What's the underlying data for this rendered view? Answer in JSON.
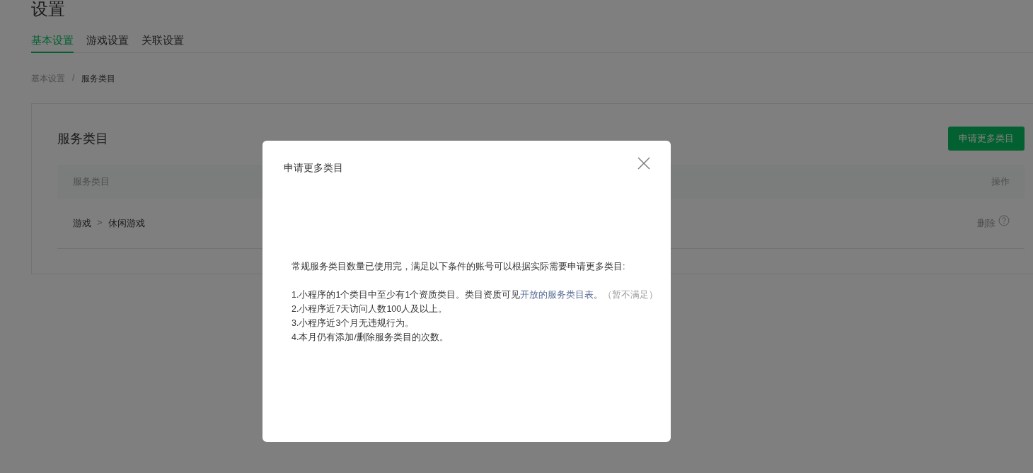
{
  "page": {
    "title": "设置"
  },
  "tabs": [
    {
      "label": "基本设置",
      "selected": true
    },
    {
      "label": "游戏设置",
      "selected": false
    },
    {
      "label": "关联设置",
      "selected": false
    }
  ],
  "breadcrumb": [
    "基本设置",
    "服务类目"
  ],
  "breadcrumb_separator": "/",
  "card": {
    "title": "服务类目",
    "button": "申请更多类目",
    "table": {
      "columns": [
        "服务类目",
        "操作"
      ],
      "rows": [
        {
          "category": [
            "游戏",
            "休闲游戏"
          ],
          "separator": ">",
          "action": "删除"
        }
      ]
    }
  },
  "dialog": {
    "title": "申请更多类目",
    "intro": "常规服务类目数量已使用完，满足以下条件的账号可以根据实际需要申请更多类目:",
    "criteria": [
      {
        "text": "1.小程序的1个类目中至少有1个资质类目。类目资质可见",
        "link": "开放的服务类目表",
        "suffix": "。",
        "note": "（暂不满足）"
      },
      {
        "text": "2.小程序近7天访问人数100人及以上。"
      },
      {
        "text": "3.小程序近3个月无违规行为。"
      },
      {
        "text": "4.本月仍有添加/删除服务类目的次数。"
      }
    ]
  }
}
